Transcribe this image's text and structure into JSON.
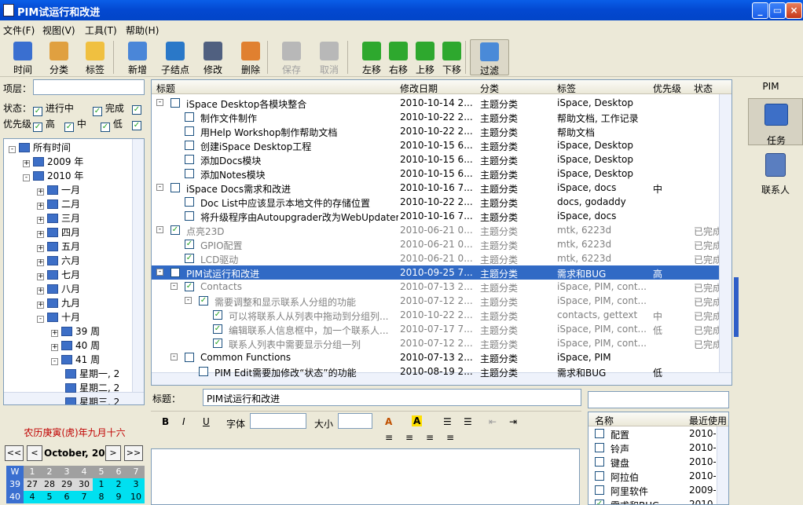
{
  "window": {
    "title": "PIM试运行和改进",
    "min": "_",
    "max": "▭",
    "close": "×"
  },
  "menu": [
    "文件(F)",
    "视图(V)",
    "工具(T)",
    "帮助(H)"
  ],
  "toolbar": [
    {
      "label": "时间",
      "color": "#3a6fd0",
      "disabled": false
    },
    {
      "label": "分类",
      "color": "#e0a040",
      "disabled": false
    },
    {
      "label": "标签",
      "color": "#f0c040",
      "disabled": false
    },
    {
      "label": "新增",
      "color": "#4a86d8",
      "disabled": false
    },
    {
      "label": "子结点",
      "color": "#2a78c8",
      "disabled": false
    },
    {
      "label": "修改",
      "color": "#506080",
      "disabled": false
    },
    {
      "label": "删除",
      "color": "#e08030",
      "disabled": false
    },
    {
      "label": "保存",
      "color": "#b8b8b8",
      "disabled": true
    },
    {
      "label": "取消",
      "color": "#b8b8b8",
      "disabled": true
    },
    {
      "label": "左移",
      "color": "#2ea82e",
      "disabled": false
    },
    {
      "label": "右移",
      "color": "#2ea82e",
      "disabled": false
    },
    {
      "label": "上移",
      "color": "#2ea82e",
      "disabled": false
    },
    {
      "label": "下移",
      "color": "#2ea82e",
      "disabled": false
    },
    {
      "label": "过滤",
      "color": "#4a8ad8",
      "disabled": false
    }
  ],
  "filter": {
    "top_label": "项层：",
    "top_value": "",
    "status_label": "状态：",
    "status_opts": [
      "进行中",
      "完成"
    ],
    "priority_label": "优先级",
    "priority_opts": [
      "高",
      "中",
      "低"
    ]
  },
  "tree": [
    {
      "label": "所有时间",
      "level": 0,
      "exp": "-"
    },
    {
      "label": "2009 年",
      "level": 1,
      "exp": "+"
    },
    {
      "label": "2010 年",
      "level": 1,
      "exp": "-"
    },
    {
      "label": "一月",
      "level": 2,
      "exp": "+"
    },
    {
      "label": "二月",
      "level": 2,
      "exp": "+"
    },
    {
      "label": "三月",
      "level": 2,
      "exp": "+"
    },
    {
      "label": "四月",
      "level": 2,
      "exp": "+"
    },
    {
      "label": "五月",
      "level": 2,
      "exp": "+"
    },
    {
      "label": "六月",
      "level": 2,
      "exp": "+"
    },
    {
      "label": "七月",
      "level": 2,
      "exp": "+"
    },
    {
      "label": "八月",
      "level": 2,
      "exp": "+"
    },
    {
      "label": "九月",
      "level": 2,
      "exp": "+"
    },
    {
      "label": "十月",
      "level": 2,
      "exp": "-"
    },
    {
      "label": "39 周",
      "level": 3,
      "exp": "+"
    },
    {
      "label": "40 周",
      "level": 3,
      "exp": "+"
    },
    {
      "label": "41 周",
      "level": 3,
      "exp": "-"
    },
    {
      "label": "星期一, 2",
      "level": 4,
      "exp": ""
    },
    {
      "label": "星期二, 2",
      "level": 4,
      "exp": ""
    },
    {
      "label": "星期三, 2",
      "level": 4,
      "exp": ""
    }
  ],
  "lunar": "农历庚寅(虎)年九月十六",
  "calendar": {
    "month": "October, 2010",
    "prev2": "<<",
    "prev": "<",
    "next": ">",
    "next2": ">>",
    "head": [
      "W",
      "1",
      "2",
      "3",
      "4",
      "5",
      "6",
      "7"
    ],
    "rows": [
      [
        "39",
        "27",
        "28",
        "29",
        "30",
        "1",
        "2",
        "3"
      ],
      [
        "40",
        "4",
        "5",
        "6",
        "7",
        "8",
        "9",
        "10"
      ]
    ]
  },
  "columns": [
    "标题",
    "修改日期",
    "分类",
    "标签",
    "优先级",
    "状态"
  ],
  "rows": [
    {
      "lvl": 0,
      "exp": "-",
      "chk": false,
      "title": "iSpace Desktop各模块整合",
      "date": "2010-10-14 2...",
      "cat": "主题分类",
      "tag": "iSpace, Desktop",
      "pri": "",
      "st": "",
      "done": false
    },
    {
      "lvl": 1,
      "exp": "",
      "chk": false,
      "title": "制作文件制作",
      "date": "2010-10-22 2...",
      "cat": "主题分类",
      "tag": "帮助文档, 工作记录",
      "pri": "",
      "st": "",
      "done": false
    },
    {
      "lvl": 1,
      "exp": "",
      "chk": false,
      "title": "用Help Workshop制作帮助文档",
      "date": "2010-10-22 2...",
      "cat": "主题分类",
      "tag": "帮助文档",
      "pri": "",
      "st": "",
      "done": false
    },
    {
      "lvl": 1,
      "exp": "",
      "chk": false,
      "title": "创建iSpace Desktop工程",
      "date": "2010-10-15 6...",
      "cat": "主题分类",
      "tag": "iSpace, Desktop",
      "pri": "",
      "st": "",
      "done": false
    },
    {
      "lvl": 1,
      "exp": "",
      "chk": false,
      "title": "添加Docs模块",
      "date": "2010-10-15 6...",
      "cat": "主题分类",
      "tag": "iSpace, Desktop",
      "pri": "",
      "st": "",
      "done": false
    },
    {
      "lvl": 1,
      "exp": "",
      "chk": false,
      "title": "添加Notes模块",
      "date": "2010-10-15 6...",
      "cat": "主题分类",
      "tag": "iSpace, Desktop",
      "pri": "",
      "st": "",
      "done": false
    },
    {
      "lvl": 0,
      "exp": "-",
      "chk": false,
      "title": "iSpace Docs需求和改进",
      "date": "2010-10-16 7...",
      "cat": "主题分类",
      "tag": "iSpace, docs",
      "pri": "中",
      "st": "",
      "done": false
    },
    {
      "lvl": 1,
      "exp": "",
      "chk": false,
      "title": "Doc List中应该显示本地文件的存储位置",
      "date": "2010-10-22 2...",
      "cat": "主题分类",
      "tag": "docs, godaddy",
      "pri": "",
      "st": "",
      "done": false
    },
    {
      "lvl": 1,
      "exp": "",
      "chk": false,
      "title": "将升级程序由Autoupgrader改为WebUpdater",
      "date": "2010-10-16 7...",
      "cat": "主题分类",
      "tag": "iSpace, docs",
      "pri": "",
      "st": "",
      "done": false
    },
    {
      "lvl": 0,
      "exp": "-",
      "chk": true,
      "title": "点亮23D",
      "date": "2010-06-21 0...",
      "cat": "主题分类",
      "tag": "mtk, 6223d",
      "pri": "",
      "st": "已完成",
      "done": true
    },
    {
      "lvl": 1,
      "exp": "",
      "chk": true,
      "title": "GPIO配置",
      "date": "2010-06-21 0...",
      "cat": "主题分类",
      "tag": "mtk, 6223d",
      "pri": "",
      "st": "已完成",
      "done": true
    },
    {
      "lvl": 1,
      "exp": "",
      "chk": true,
      "title": "LCD驱动",
      "date": "2010-06-21 0...",
      "cat": "主题分类",
      "tag": "mtk, 6223d",
      "pri": "",
      "st": "已完成",
      "done": true
    },
    {
      "lvl": 0,
      "exp": "-",
      "chk": false,
      "title": "PIM试运行和改进",
      "date": "2010-09-25 7...",
      "cat": "主题分类",
      "tag": "需求和BUG",
      "pri": "高",
      "st": "",
      "done": false,
      "sel": true
    },
    {
      "lvl": 1,
      "exp": "-",
      "chk": true,
      "title": "Contacts",
      "date": "2010-07-13 2...",
      "cat": "主题分类",
      "tag": "iSpace, PIM, cont...",
      "pri": "",
      "st": "已完成",
      "done": true
    },
    {
      "lvl": 2,
      "exp": "-",
      "chk": true,
      "title": "需要调整和显示联系人分组的功能",
      "date": "2010-07-12 2...",
      "cat": "主题分类",
      "tag": "iSpace, PIM, cont...",
      "pri": "",
      "st": "已完成",
      "done": true
    },
    {
      "lvl": 3,
      "exp": "",
      "chk": true,
      "title": "可以将联系人从列表中拖动到分组列...",
      "date": "2010-10-22 2...",
      "cat": "主题分类",
      "tag": "contacts, gettext",
      "pri": "中",
      "st": "已完成",
      "done": true
    },
    {
      "lvl": 3,
      "exp": "",
      "chk": true,
      "title": "编辑联系人信息框中，加一个联系人...",
      "date": "2010-07-17 7...",
      "cat": "主题分类",
      "tag": "iSpace, PIM, cont...",
      "pri": "低",
      "st": "已完成",
      "done": true
    },
    {
      "lvl": 3,
      "exp": "",
      "chk": true,
      "title": "联系人列表中需要显示分组一列",
      "date": "2010-07-12 2...",
      "cat": "主题分类",
      "tag": "iSpace, PIM, cont...",
      "pri": "",
      "st": "已完成",
      "done": true
    },
    {
      "lvl": 1,
      "exp": "-",
      "chk": false,
      "title": "Common Functions",
      "date": "2010-07-13 2...",
      "cat": "主题分类",
      "tag": "iSpace, PIM",
      "pri": "",
      "st": "",
      "done": false
    },
    {
      "lvl": 2,
      "exp": "",
      "chk": false,
      "title": "PIM Edit需要加修改“状态”的功能",
      "date": "2010-08-19 2...",
      "cat": "主题分类",
      "tag": "需求和BUG",
      "pri": "低",
      "st": "",
      "done": false
    }
  ],
  "right_panel": {
    "title": "PIM",
    "items": [
      "任务",
      "联系人"
    ]
  },
  "editor": {
    "title_label": "标题：",
    "title_value": "PIM试运行和改进",
    "font_label": "字体",
    "size_label": "大小"
  },
  "tags": {
    "columns": [
      "名称",
      "最近使用"
    ],
    "items": [
      {
        "name": "配置",
        "date": "2010-0",
        "chk": false
      },
      {
        "name": "铃声",
        "date": "2010-0",
        "chk": false
      },
      {
        "name": "键盘",
        "date": "2010-0",
        "chk": false
      },
      {
        "name": "阿拉伯",
        "date": "2010-0",
        "chk": false
      },
      {
        "name": "阿里软件",
        "date": "2009-0",
        "chk": false
      },
      {
        "name": "需求和BUG",
        "date": "2010-0",
        "chk": true
      }
    ]
  }
}
